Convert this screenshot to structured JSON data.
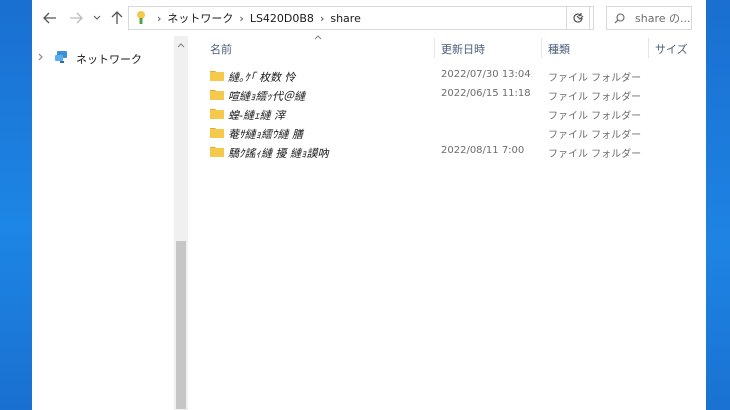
{
  "toolbar": {
    "back": "back-arrow",
    "forward": "forward-arrow",
    "recent": "chevron-down",
    "up": "up-arrow"
  },
  "address": {
    "crumbs": [
      "ネットワーク",
      "LS420D0B8",
      "share"
    ],
    "separator": "›"
  },
  "search": {
    "placeholder": "share の..."
  },
  "navpane": {
    "items": [
      {
        "label": "ネットワーク"
      }
    ]
  },
  "columns": {
    "name": "名前",
    "date": "更新日時",
    "type": "種類",
    "size": "サイズ"
  },
  "files": [
    {
      "name": "縺｡ｹ｢ 枚数 怜",
      "date": "2022/07/30 13:04",
      "type": "ファイル フォルダー"
    },
    {
      "name": "喧縺ｮ繧ｯ代＠縺",
      "date": "2022/06/15 11:18",
      "type": "ファイル フォルダー"
    },
    {
      "name": "蝗-縺ｪ縺 滓",
      "date": "",
      "type": "ファイル フォルダー"
    },
    {
      "name": "菴ｻ縺ｮ繧ｳ縺 膳",
      "date": "",
      "type": "ファイル フォルダー"
    },
    {
      "name": "驕ｸ謠ｨ縺 擾 縺ｮ謨吶",
      "date": "2022/08/11 7:00",
      "type": "ファイル フォルダー"
    }
  ],
  "colors": {
    "desktop": "#1777d6",
    "folder": "#f5c94c",
    "folder_dark": "#e0ac2c",
    "header_text": "#4c607a"
  }
}
